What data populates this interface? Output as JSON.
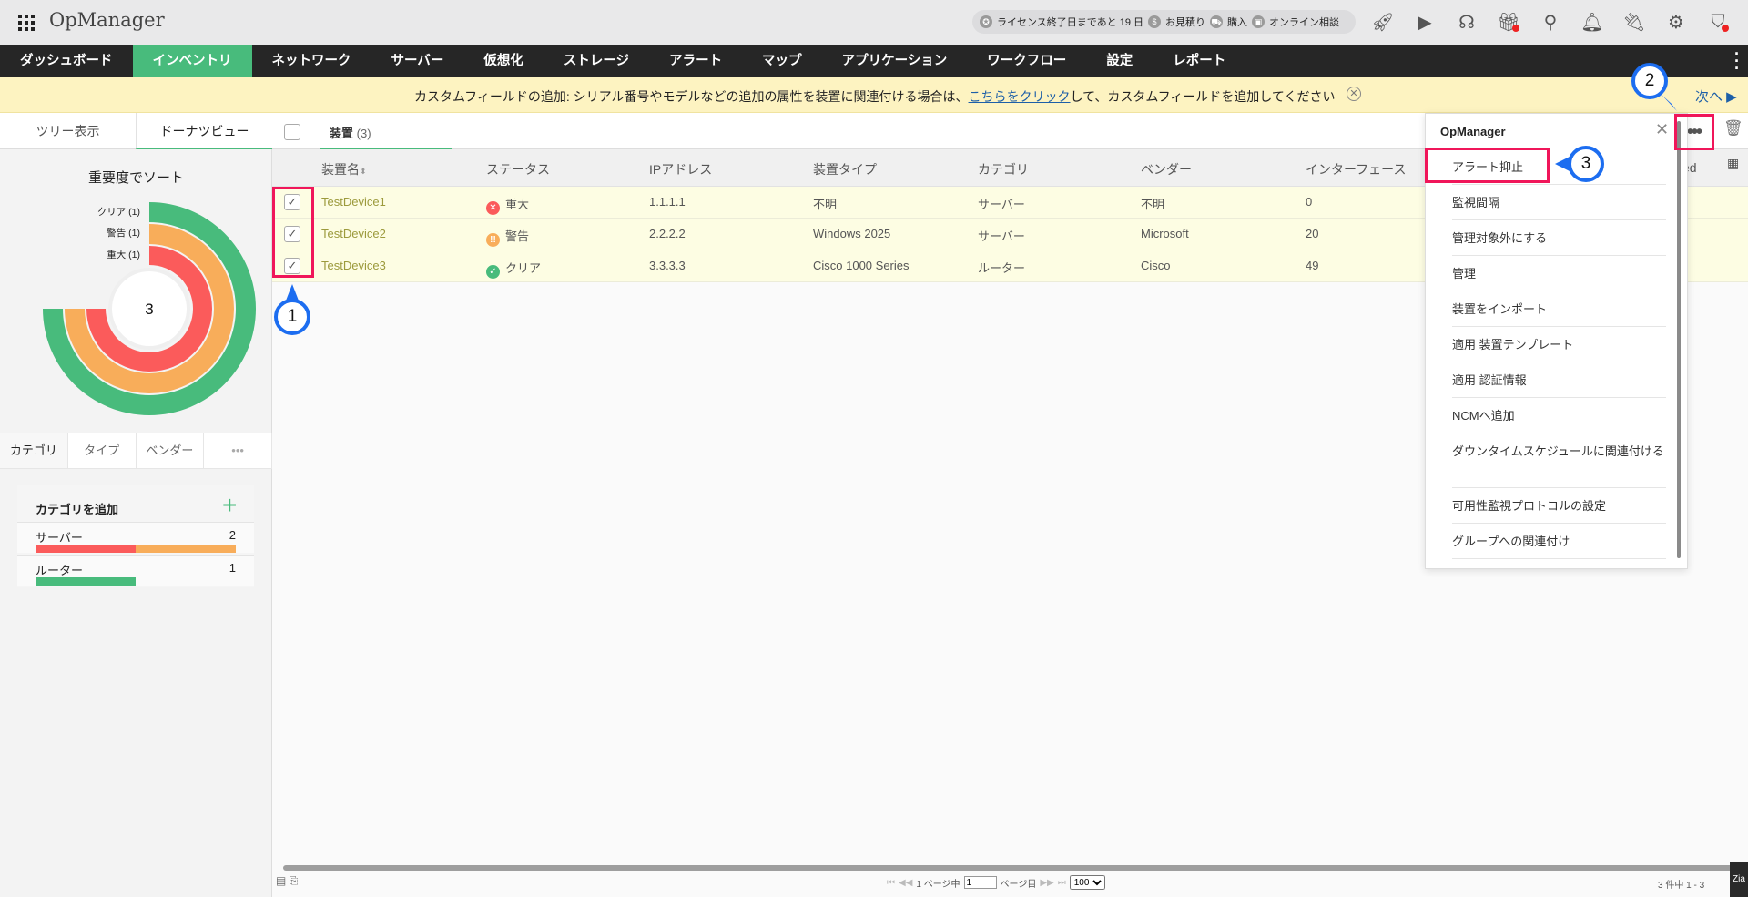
{
  "app": {
    "title": "OpMenu",
    "name": "OpManager"
  },
  "header": {
    "license": "ライセンス終了日まであと 19 日",
    "quote": "お見積り",
    "buy": "購入",
    "consult": "オンライン相談"
  },
  "nav": [
    "ダッシュボード",
    "インベントリ",
    "ネットワーク",
    "サーバー",
    "仮想化",
    "ストレージ",
    "アラート",
    "マップ",
    "アプリケーション",
    "ワークフロー",
    "設定",
    "レポート"
  ],
  "banner": {
    "before": "カスタムフィールドの追加: シリアル番号やモデルなどの追加の属性を装置に関連付ける場合は、",
    "link": "こちらをクリック",
    "after": "して、カスタムフィールドを追加してください",
    "next": "次へ"
  },
  "left": {
    "tabs": [
      "ツリー表示",
      "ドーナツビュー"
    ],
    "sort_title": "重要度でソート",
    "donut": {
      "total": "3",
      "legend": [
        {
          "label": "クリア (1)",
          "color": "#48bb7c",
          "value": 1
        },
        {
          "label": "警告 (1)",
          "color": "#f8ad5a",
          "value": 1
        },
        {
          "label": "重大 (1)",
          "color": "#fb5b5b",
          "value": 1
        }
      ]
    },
    "cat_tabs": [
      "カテゴリ",
      "タイプ",
      "ベンダー",
      "•••"
    ],
    "cat_box": {
      "title": "カテゴリを追加",
      "items": [
        {
          "name": "サーバー",
          "count": "2"
        },
        {
          "name": "ルーター",
          "count": "1"
        }
      ]
    }
  },
  "main": {
    "tab_label": "装置",
    "tab_count": "(3)",
    "columns": [
      "装置名",
      "ステータス",
      "IPアドレス",
      "装置タイプ",
      "カテゴリ",
      "ベンダー",
      "インターフェース"
    ],
    "col_cut": "ed",
    "rows": [
      {
        "name": "TestDevice1",
        "status": "重大",
        "ip": "1.1.1.1",
        "type": "不明",
        "category": "サーバー",
        "vendor": "不明",
        "interfaces": "0"
      },
      {
        "name": "TestDevice2",
        "status": "警告",
        "ip": "2.2.2.2",
        "type": "Windows 2025",
        "category": "サーバー",
        "vendor": "Microsoft",
        "interfaces": "20"
      },
      {
        "name": "TestDevice3",
        "status": "クリア",
        "ip": "3.3.3.3",
        "type": "Cisco 1000 Series",
        "category": "ルーター",
        "vendor": "Cisco",
        "interfaces": "49"
      }
    ]
  },
  "menu": {
    "title": "OpManager",
    "items": [
      "アラート抑止",
      "監視間隔",
      "管理対象外にする",
      "管理",
      "装置をインポート",
      "適用 装置テンプレート",
      "適用 認証情報",
      "NCMへ追加",
      "ダウンタイムスケジュールに関連付ける",
      "可用性監視プロトコルの設定",
      "グループへの関連付け"
    ]
  },
  "footer": {
    "page_prefix": "1 ページ中",
    "page_value": "1",
    "page_suffix": "ページ目",
    "per_page": "100",
    "count": "3 件中 1 - 3",
    "zia": "Zia"
  },
  "callouts": [
    "1",
    "2",
    "3"
  ],
  "colors": {
    "accent": "#48bb7c",
    "critical": "#fb5b5b",
    "warning": "#f8ad5a",
    "clear": "#48bb7c",
    "annotation": "#f0165a",
    "callout": "#1c6df0"
  }
}
